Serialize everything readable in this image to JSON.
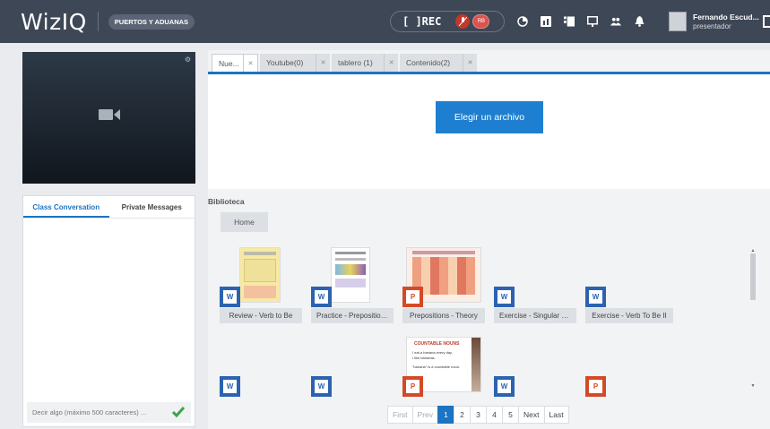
{
  "header": {
    "logo": "WizIQ",
    "class_name": "PUERTOS Y ADUANAS",
    "rec_label": "[ ]REC",
    "rd_label": "RB",
    "user_name": "Fernando Escud...",
    "user_role": "presentador"
  },
  "video": {
    "settings_icon": "gear-icon",
    "camera_icon": "camera-icon"
  },
  "chat": {
    "tabs": [
      "Class Conversation",
      "Private Messages"
    ],
    "input_placeholder": "Decir algo (máximo 500 caracteres) ...",
    "send_icon": "check-icon"
  },
  "content_tabs": [
    {
      "label": "Nue..."
    },
    {
      "label": "Youtube(0)"
    },
    {
      "label": "tablero (1)"
    },
    {
      "label": "Contenido(2)"
    }
  ],
  "upload": {
    "button_label": "Elegir un archivo"
  },
  "library": {
    "title": "Biblioteca",
    "home_label": "Home",
    "files": [
      {
        "name": "Review - Verb to Be",
        "type": "word"
      },
      {
        "name": "Practice - Preposition...",
        "type": "word"
      },
      {
        "name": "Prepositions - Theory",
        "type": "ppt"
      },
      {
        "name": "Exercise - Singular an...",
        "type": "word"
      },
      {
        "name": "Exercise - Verb To Be II",
        "type": "word"
      },
      {
        "name": "",
        "type": "word"
      },
      {
        "name": "",
        "type": "word"
      },
      {
        "name": "",
        "type": "ppt"
      },
      {
        "name": "",
        "type": "word"
      },
      {
        "name": "",
        "type": "ppt"
      }
    ],
    "thumb_text": {
      "countable_title": "COUNTABLE NOUNS",
      "countable_line1": "I eat a banana every day.",
      "countable_line2": "I like bananas.",
      "countable_line3": "\"banana\" is a countable noun."
    }
  },
  "pagination": {
    "first": "First",
    "prev": "Prev",
    "pages": [
      "1",
      "2",
      "3",
      "4",
      "5"
    ],
    "current_page": "1",
    "next": "Next",
    "last": "Last"
  },
  "colors": {
    "accent": "#1c74c2",
    "topbar": "#3e4756",
    "word": "#2b63b0",
    "ppt": "#d44a26"
  }
}
